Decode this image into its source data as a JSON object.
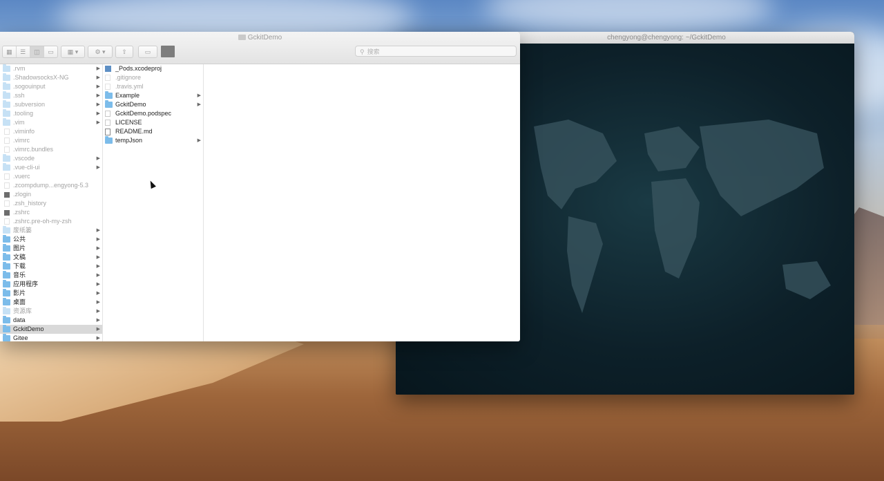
{
  "terminal": {
    "title": "chengyong@chengyong: ~/GckitDemo"
  },
  "finder": {
    "title": "GckitDemo",
    "search_placeholder": "搜索",
    "column1": [
      {
        "name": ".rvm",
        "type": "folder",
        "dim": true,
        "arrow": true
      },
      {
        "name": ".ShadowsocksX-NG",
        "type": "folder",
        "dim": true,
        "arrow": true
      },
      {
        "name": ".sogouinput",
        "type": "folder",
        "dim": true,
        "arrow": true
      },
      {
        "name": ".ssh",
        "type": "folder",
        "dim": true,
        "arrow": true
      },
      {
        "name": ".subversion",
        "type": "folder",
        "dim": true,
        "arrow": true
      },
      {
        "name": ".tooling",
        "type": "folder",
        "dim": true,
        "arrow": true
      },
      {
        "name": ".vim",
        "type": "folder",
        "dim": true,
        "arrow": true
      },
      {
        "name": ".viminfo",
        "type": "file",
        "dim": true,
        "arrow": false
      },
      {
        "name": ".vimrc",
        "type": "file",
        "dim": true,
        "arrow": false
      },
      {
        "name": ".vimrc.bundles",
        "type": "file",
        "dim": true,
        "arrow": false
      },
      {
        "name": ".vscode",
        "type": "folder",
        "dim": true,
        "arrow": true
      },
      {
        "name": ".vue-cli-ui",
        "type": "folder",
        "dim": true,
        "arrow": true
      },
      {
        "name": ".vuerc",
        "type": "file",
        "dim": true,
        "arrow": false
      },
      {
        "name": ".zcompdump...engyong-5.3",
        "type": "file",
        "dim": true,
        "arrow": false
      },
      {
        "name": ".zlogin",
        "type": "dark-file",
        "dim": true,
        "arrow": false
      },
      {
        "name": ".zsh_history",
        "type": "file",
        "dim": true,
        "arrow": false
      },
      {
        "name": ".zshrc",
        "type": "dark-file",
        "dim": true,
        "arrow": false
      },
      {
        "name": ".zshrc.pre-oh-my-zsh",
        "type": "file",
        "dim": true,
        "arrow": false
      },
      {
        "name": "废纸篓",
        "type": "folder",
        "dim": true,
        "arrow": true
      },
      {
        "name": "公共",
        "type": "folder",
        "dim": false,
        "arrow": true
      },
      {
        "name": "图片",
        "type": "folder",
        "dim": false,
        "arrow": true
      },
      {
        "name": "文稿",
        "type": "folder",
        "dim": false,
        "arrow": true
      },
      {
        "name": "下载",
        "type": "folder",
        "dim": false,
        "arrow": true
      },
      {
        "name": "音乐",
        "type": "folder",
        "dim": false,
        "arrow": true
      },
      {
        "name": "应用程序",
        "type": "folder",
        "dim": false,
        "arrow": true
      },
      {
        "name": "影片",
        "type": "folder",
        "dim": false,
        "arrow": true
      },
      {
        "name": "桌面",
        "type": "folder",
        "dim": false,
        "arrow": true
      },
      {
        "name": "资源库",
        "type": "folder",
        "dim": true,
        "arrow": true
      },
      {
        "name": "data",
        "type": "folder",
        "dim": false,
        "arrow": true
      },
      {
        "name": "GckitDemo",
        "type": "folder",
        "dim": false,
        "arrow": true,
        "selected": true
      },
      {
        "name": "Gitee",
        "type": "folder",
        "dim": false,
        "arrow": true
      }
    ],
    "column2": [
      {
        "name": "_Pods.xcodeproj",
        "type": "xcode",
        "dim": false,
        "arrow": false
      },
      {
        "name": ".gitignore",
        "type": "file",
        "dim": true,
        "arrow": false
      },
      {
        "name": ".travis.yml",
        "type": "file",
        "dim": true,
        "arrow": false
      },
      {
        "name": "Example",
        "type": "folder",
        "dim": false,
        "arrow": true
      },
      {
        "name": "GckitDemo",
        "type": "folder",
        "dim": false,
        "arrow": true
      },
      {
        "name": "GckitDemo.podspec",
        "type": "file",
        "dim": false,
        "arrow": false
      },
      {
        "name": "LICENSE",
        "type": "file",
        "dim": false,
        "arrow": false
      },
      {
        "name": "README.md",
        "type": "md",
        "dim": false,
        "arrow": false
      },
      {
        "name": "tempJson",
        "type": "folder",
        "dim": false,
        "arrow": true
      }
    ]
  }
}
